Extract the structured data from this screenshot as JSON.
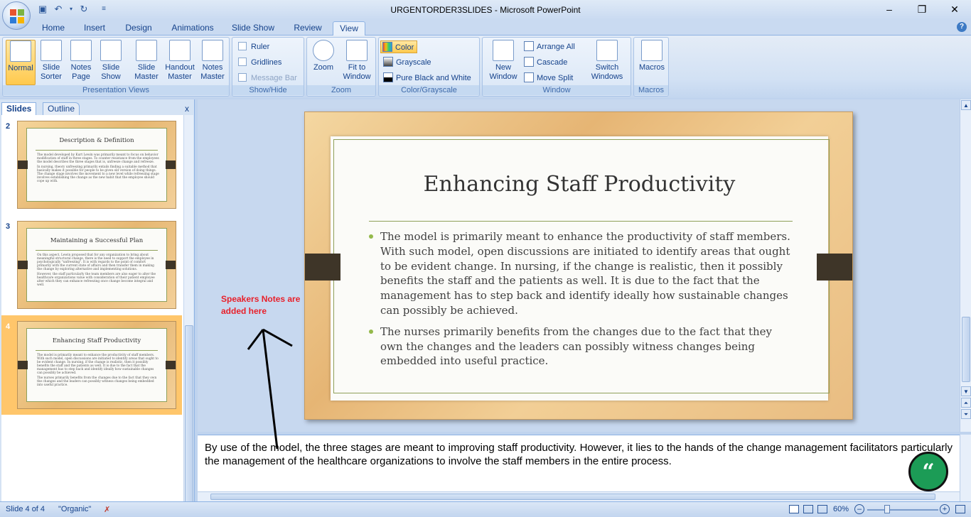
{
  "window": {
    "title": "URGENTORDER3SLIDES - Microsoft PowerPoint",
    "controls": [
      "minimize",
      "restore",
      "close"
    ]
  },
  "quick_access": [
    "save-icon",
    "undo-icon",
    "redo-icon",
    "customize-icon"
  ],
  "tabs": [
    "Home",
    "Insert",
    "Design",
    "Animations",
    "Slide Show",
    "Review",
    "View"
  ],
  "active_tab": "View",
  "ribbon": {
    "presentation_views": {
      "label": "Presentation Views",
      "buttons": [
        {
          "label": "Normal",
          "selected": true
        },
        {
          "label": "Slide Sorter"
        },
        {
          "label": "Notes Page"
        },
        {
          "label": "Slide Show"
        },
        {
          "label": "Slide Master"
        },
        {
          "label": "Handout Master"
        },
        {
          "label": "Notes Master"
        }
      ]
    },
    "show_hide": {
      "label": "Show/Hide",
      "items": [
        {
          "label": "Ruler",
          "checked": false
        },
        {
          "label": "Gridlines",
          "checked": false
        },
        {
          "label": "Message Bar",
          "checked": false,
          "disabled": true
        }
      ]
    },
    "zoom": {
      "label": "Zoom",
      "buttons": [
        "Zoom",
        "Fit to Window"
      ]
    },
    "color_grayscale": {
      "label": "Color/Grayscale",
      "items": [
        "Color",
        "Grayscale",
        "Pure Black and White"
      ]
    },
    "window": {
      "label": "Window",
      "new_window": "New Window",
      "items": [
        "Arrange All",
        "Cascade",
        "Move Split"
      ],
      "switch": "Switch Windows"
    },
    "macros": {
      "label": "Macros",
      "button": "Macros"
    }
  },
  "panel": {
    "tabs": [
      "Slides",
      "Outline"
    ],
    "close": "x",
    "slides": [
      {
        "number": "2",
        "title": "Description & Definition",
        "bullets": [
          "The model developed by Kurt Lewin was primarily meant to focus on behavior modification of staff in three stages. To counter resistance from the employees the model describes the three stages that is, unfreeze change and refreeze.",
          "In nursing, theory unfreezing primarily entails finding a suitable method that basically makes it possible for people to be given old version of doing things. The change stage involves the movement to a new level while refreezing stage involves establishing the change as the new habit that the employee should cope up with."
        ]
      },
      {
        "number": "3",
        "title": "Maintaining a Successful Plan",
        "bullets": [
          "On this aspect, Lewin proposed that for any organization to bring about meaningful structural change, there is the need to support the employee in psychologically \"unfreezing\". It is with regards to the point of comfort primarily with the current state of affairs and then transfer them in making the change by exploring alternative and implementing solutions.",
          "However, the staff particularly the team members are also eager to alter the healthcare organizations value with consideration of their patient employee alter which they can enhance refreezing once change become integral and well."
        ]
      },
      {
        "number": "4",
        "title": "Enhancing Staff Productivity",
        "selected": true,
        "bullets": [
          "The model is primarily meant to enhance the productivity of staff members. With such model, open discussions are initiated to identify areas that ought to be evident change. In nursing, if the change is realistic, then it possibly benefits the staff and the patients as well. It is due to the fact that the management has to step back and identify ideally how sustainable changes can possibly be achieved.",
          "The nurses primarily benefits from the changes due to the fact that they own the changes and the leaders can possibly witness changes being embedded into useful practice."
        ]
      }
    ]
  },
  "slide": {
    "title": "Enhancing Staff Productivity",
    "bullets": [
      "The model is primarily meant to enhance the productivity of staff members. With such model, open discussions are initiated to identify areas that ought to be evident change. In nursing, if the change is realistic, then it possibly benefits the staff and the patients as well. It is due to the fact that the management has to step back and identify ideally how sustainable changes can possibly be achieved.",
      "The nurses primarily benefits from the changes due to the fact that they own the changes and the leaders can possibly witness changes being embedded into useful practice."
    ]
  },
  "annotation": "Speakers Notes are added here",
  "notes": "By use of the model, the three stages are meant to improving staff productivity. However, it lies to the hands of the change management facilitators particularly the management of the healthcare organizations to involve the staff members in the entire process.",
  "quote_icon": "“",
  "status": {
    "slide": "Slide 4 of 4",
    "theme": "\"Organic\"",
    "zoom": "60%"
  },
  "colors": {
    "ribbon": "#d2e1f4",
    "selected": "#ffc66b",
    "slide_border": "#8fa05a",
    "bullet": "#94b94b",
    "annotation": "#e8202a",
    "quote_badge": "#1c9c56"
  }
}
